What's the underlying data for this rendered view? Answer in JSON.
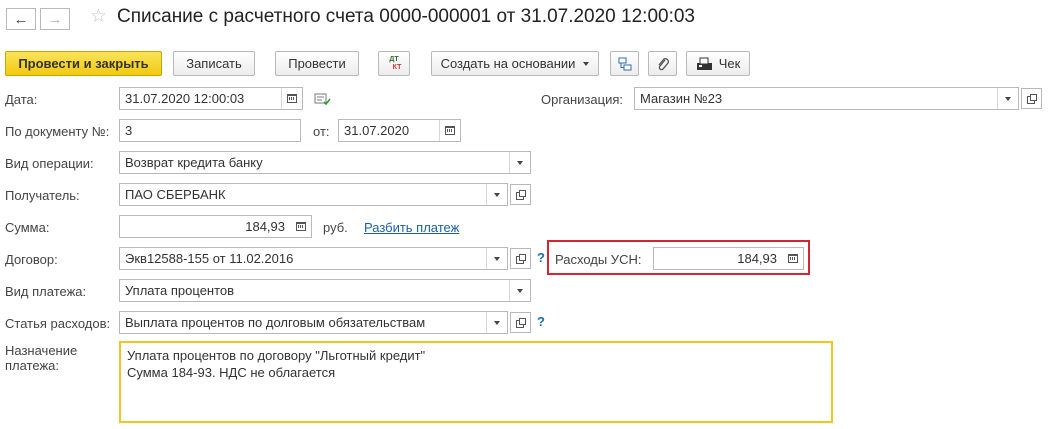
{
  "window": {
    "title": "Списание с расчетного счета 0000-000001 от 31.07.2020 12:00:03",
    "back_icon": "←",
    "forward_icon": "→",
    "star_icon": "☆"
  },
  "toolbar": {
    "post_close": "Провести и закрыть",
    "save": "Записать",
    "post": "Провести",
    "dtkt_top": "ДТ",
    "dtkt_bottom": "КТ",
    "create_based": "Создать на основании",
    "check": "Чек"
  },
  "form": {
    "date_label": "Дата:",
    "date_value": "31.07.2020 12:00:03",
    "org_label": "Организация:",
    "org_value": "Магазин №23",
    "doc_num_label": "По документу №:",
    "doc_num_value": "3",
    "from_label": "от:",
    "from_value": "31.07.2020",
    "op_type_label": "Вид операции:",
    "op_type_value": "Возврат кредита банку",
    "recipient_label": "Получатель:",
    "recipient_value": "ПАО СБЕРБАНК",
    "sum_label": "Сумма:",
    "sum_value": "184,93",
    "currency": "руб.",
    "split_link": "Разбить платеж",
    "contract_label": "Договор:",
    "contract_value": "Экв12588-155 от 11.02.2016",
    "help": "?",
    "usn_label": "Расходы УСН:",
    "usn_value": "184,93",
    "payment_type_label": "Вид платежа:",
    "payment_type_value": "Уплата процентов",
    "expense_label": "Статья расходов:",
    "expense_value": "Выплата процентов по долговым обязательствам",
    "purpose_label": "Назначение платежа:",
    "purpose_text": "Уплата процентов по договору \"Льготный кредит\"\nСумма 184-93. НДС не облагается"
  }
}
